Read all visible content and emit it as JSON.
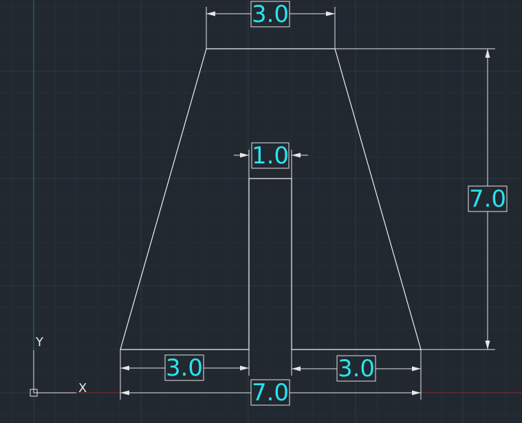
{
  "colors": {
    "background": "#212830",
    "geometry": "#f2f2f2",
    "dimension_text": "#29e4f0",
    "x_axis": "#8a2a2a",
    "y_axis": "#2f7a3a"
  },
  "dimensions": {
    "top_width": "3.0",
    "slot_width": "1.0",
    "height": "7.0",
    "bottom_left": "3.0",
    "bottom_right": "3.0",
    "bottom_total": "7.0"
  },
  "ucs": {
    "x_label": "X",
    "y_label": "Y"
  }
}
